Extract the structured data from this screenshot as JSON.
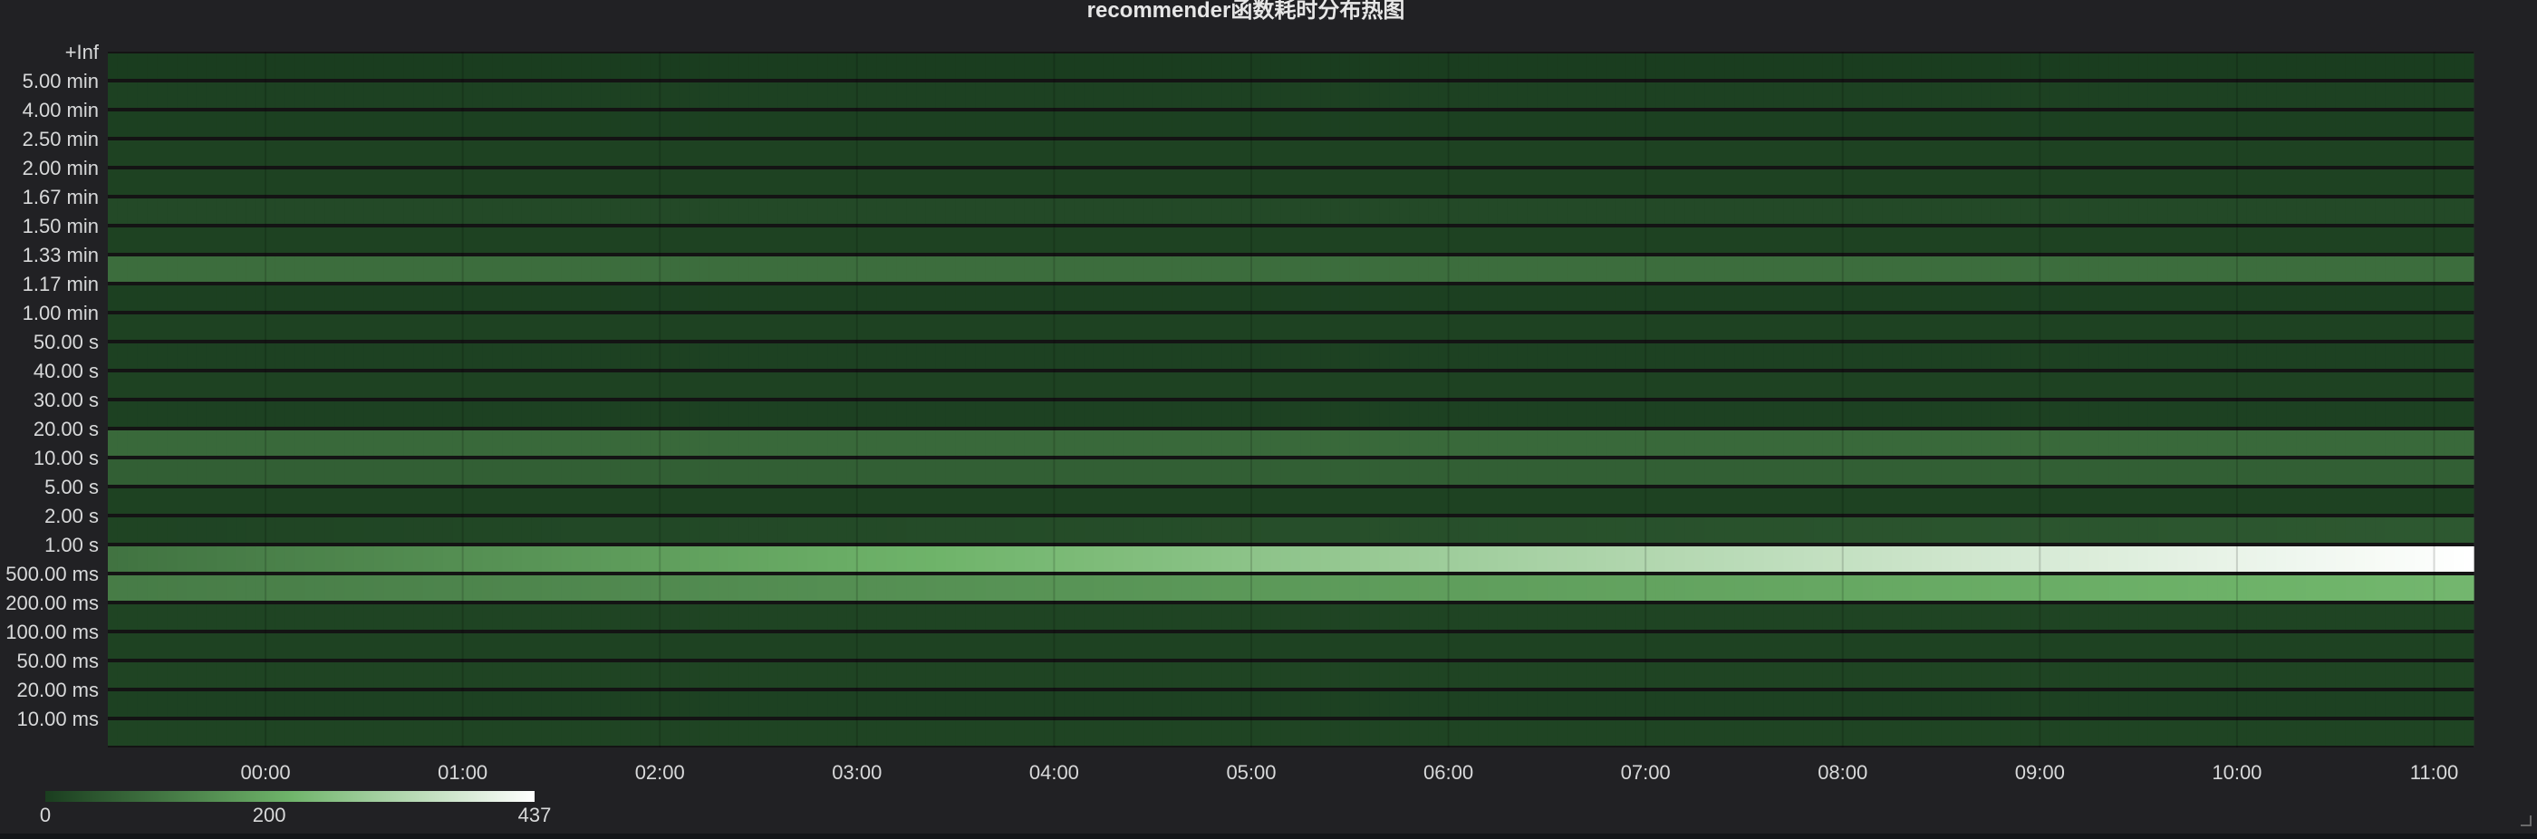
{
  "chart_data": {
    "type": "heatmap",
    "title": "recommender函数耗时分布热图",
    "y_buckets": [
      "+Inf",
      "5.00 min",
      "4.00 min",
      "2.50 min",
      "2.00 min",
      "1.67 min",
      "1.50 min",
      "1.33 min",
      "1.17 min",
      "1.00 min",
      "50.00 s",
      "40.00 s",
      "30.00 s",
      "20.00 s",
      "10.00 s",
      "5.00 s",
      "2.00 s",
      "1.00 s",
      "500.00 ms",
      "200.00 ms",
      "100.00 ms",
      "50.00 ms",
      "20.00 ms",
      "10.00 ms"
    ],
    "x_ticks": [
      "00:00",
      "01:00",
      "02:00",
      "03:00",
      "04:00",
      "05:00",
      "06:00",
      "07:00",
      "08:00",
      "09:00",
      "10:00",
      "11:00"
    ],
    "x_range_hours": [
      -0.8,
      11.2
    ],
    "color_scale": {
      "min": 0,
      "max": 437,
      "tick_labels": [
        "0",
        "200",
        "437"
      ],
      "color_min": "#1a3d1f",
      "color_mid": "#6fb46a",
      "color_max": "#ffffff"
    },
    "rows": [
      {
        "start": 0,
        "end": 0,
        "label": "+Inf"
      },
      {
        "start": 8,
        "end": 8,
        "label": "5.00 min"
      },
      {
        "start": 6,
        "end": 6,
        "label": "4.00 min"
      },
      {
        "start": 10,
        "end": 10,
        "label": "2.50 min"
      },
      {
        "start": 10,
        "end": 10,
        "label": "2.00 min"
      },
      {
        "start": 22,
        "end": 22,
        "label": "1.67 min"
      },
      {
        "start": 10,
        "end": 10,
        "label": "1.50 min"
      },
      {
        "start": 88,
        "end": 88,
        "label": "1.33 min"
      },
      {
        "start": 6,
        "end": 6,
        "label": "1.17 min"
      },
      {
        "start": 10,
        "end": 10,
        "label": "1.00 min"
      },
      {
        "start": 8,
        "end": 8,
        "label": "50.00 s"
      },
      {
        "start": 10,
        "end": 10,
        "label": "40.00 s"
      },
      {
        "start": 8,
        "end": 8,
        "label": "30.00 s"
      },
      {
        "start": 80,
        "end": 80,
        "label": "20.00 s"
      },
      {
        "start": 62,
        "end": 62,
        "label": "10.00 s"
      },
      {
        "start": 10,
        "end": 10,
        "label": "5.00 s"
      },
      {
        "start": 12,
        "end": 50,
        "label": "2.00 s"
      },
      {
        "start": 100,
        "end": 437,
        "label": "1.00 s"
      },
      {
        "start": 115,
        "end": 225,
        "label": "500.00 ms"
      },
      {
        "start": 12,
        "end": 12,
        "label": "200.00 ms"
      },
      {
        "start": 10,
        "end": 10,
        "label": "100.00 ms"
      },
      {
        "start": 12,
        "end": 12,
        "label": "50.00 ms"
      },
      {
        "start": 8,
        "end": 8,
        "label": "20.00 ms"
      },
      {
        "start": 12,
        "end": 12,
        "label": "10.00 ms"
      }
    ],
    "grid": true,
    "legend": "bottom-left"
  }
}
